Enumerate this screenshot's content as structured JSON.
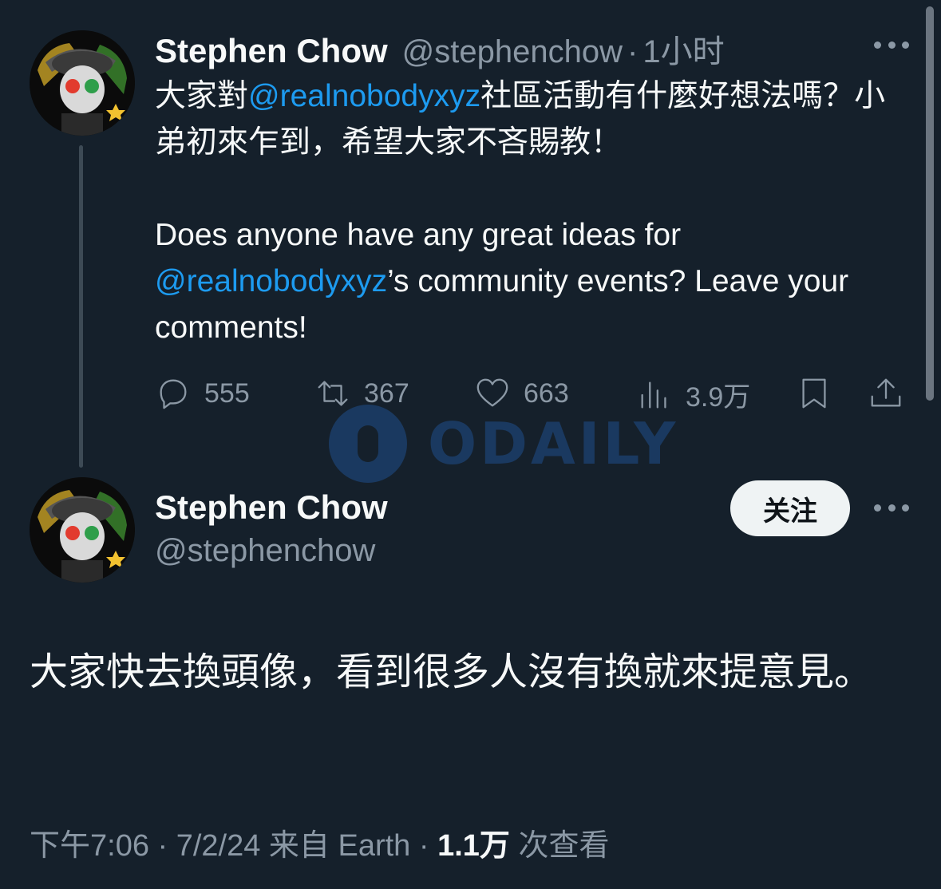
{
  "reply_tweet": {
    "author_name": "Stephen Chow",
    "handle": "@stephenchow",
    "separator": "·",
    "time_ago": "1小时",
    "text_zh_before": "大家對",
    "mention": "@realnobodyxyz",
    "text_zh_after": "社區活動有什麼好想法嗎？小弟初來乍到，希望大家不吝賜教！",
    "text_en_before": "Does anyone have any great ideas for ",
    "text_en_after": "’s community events? Leave your comments!",
    "stats": {
      "replies": "555",
      "retweets": "367",
      "likes": "663",
      "views": "3.9万"
    }
  },
  "main_tweet": {
    "author_name": "Stephen Chow",
    "handle": "@stephenchow",
    "follow_label": "关注",
    "text": "大家快去換頭像，看到很多人沒有換就來提意見。",
    "meta_time": "下午7:06 · 7/2/24 来自 Earth · ",
    "meta_views": "1.1万",
    "meta_views_suffix": " 次查看"
  },
  "watermark": "ODAILY",
  "colors": {
    "background": "#15202b",
    "accent": "#1d9bf0",
    "secondary_text": "#8b98a5"
  },
  "icons": [
    "reply-icon",
    "retweet-icon",
    "like-icon",
    "views-icon",
    "bookmark-icon",
    "share-icon",
    "more-icon"
  ]
}
